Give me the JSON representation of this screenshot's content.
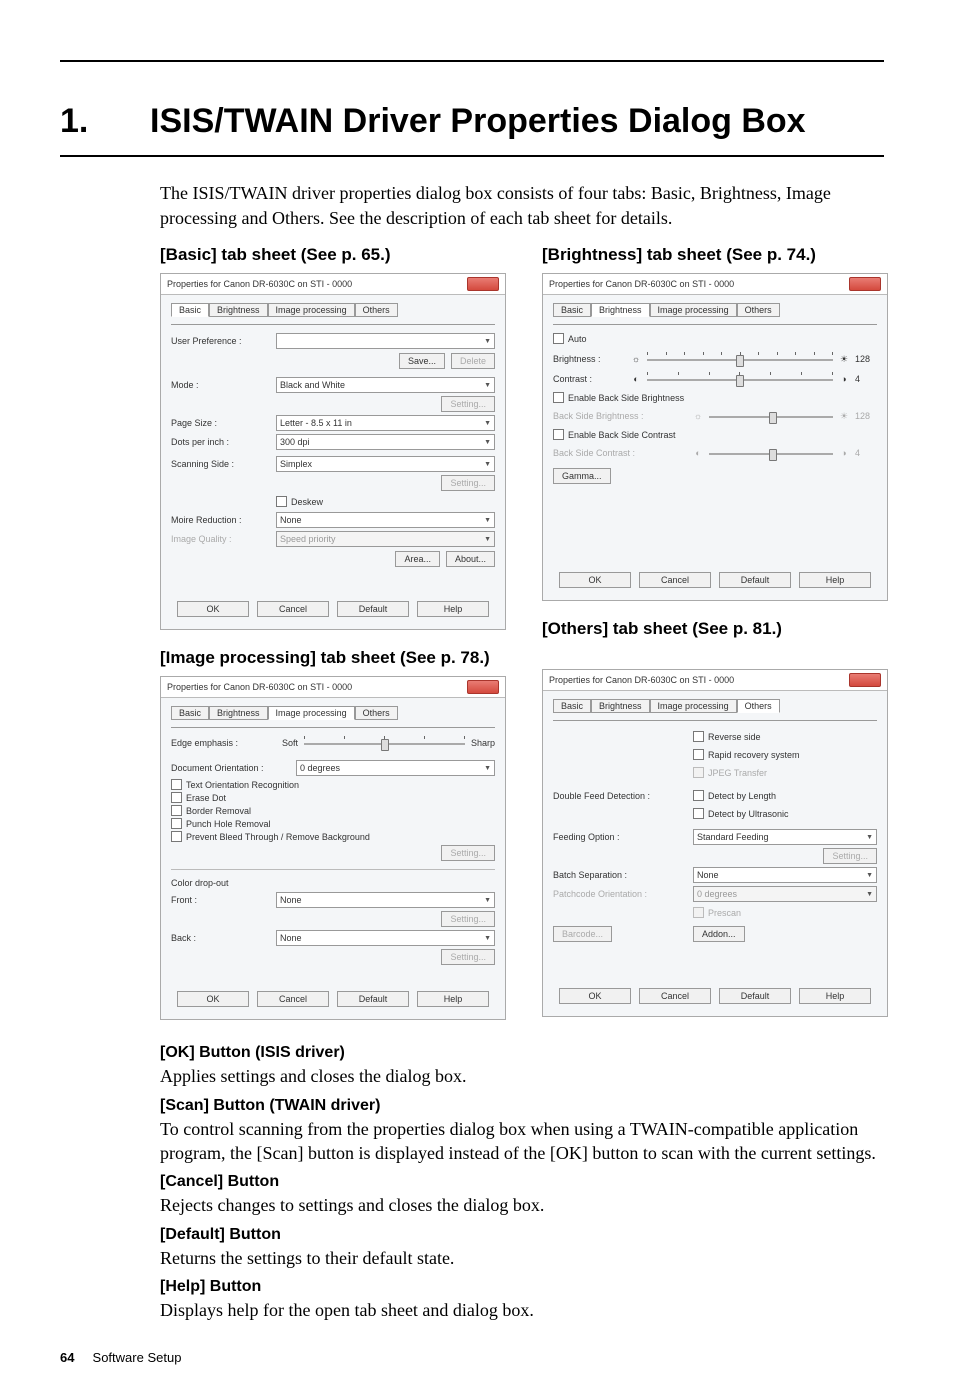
{
  "page_number": "64",
  "footer_label": "Software Setup",
  "chapter": {
    "number": "1.",
    "title": "ISIS/TWAIN Driver Properties Dialog Box"
  },
  "intro": "The ISIS/TWAIN driver properties dialog box consists of four tabs: Basic, Brightness, Image processing and Others. See the description of each tab sheet for details.",
  "sections": {
    "basic": "[Basic] tab sheet (See p. 65.)",
    "brightness": "[Brightness] tab sheet (See p. 74.)",
    "image_processing_title": "[Image processing] tab sheet (See p. 78.)",
    "others": "[Others] tab sheet (See p. 81.)"
  },
  "buttons_explain": {
    "ok_title": "[OK] Button (ISIS driver)",
    "ok_text": "Applies settings and closes the dialog box.",
    "scan_title": "[Scan] Button (TWAIN driver)",
    "scan_text": "To control scanning from the properties dialog box when using a TWAIN-compatible application program, the [Scan] button is displayed instead of the [OK] button to scan with the current settings.",
    "cancel_title": "[Cancel] Button",
    "cancel_text": "Rejects changes to settings and closes the dialog box.",
    "default_title": "[Default] Button",
    "default_text": "Returns the settings to their default state.",
    "help_title": "[Help] Button",
    "help_text": "Displays help for the open tab sheet and dialog box."
  },
  "dialog": {
    "window_title": "Properties for Canon DR-6030C on STI - 0000",
    "tabs": {
      "basic": "Basic",
      "brightness": "Brightness",
      "image_processing": "Image processing",
      "others": "Others"
    },
    "footer_buttons": {
      "ok": "OK",
      "cancel": "Cancel",
      "default": "Default",
      "help": "Help"
    }
  },
  "basic_tab": {
    "user_preference": "User Preference :",
    "save": "Save...",
    "delete": "Delete",
    "mode": "Mode :",
    "mode_val": "Black and White",
    "setting": "Setting...",
    "page_size": "Page Size :",
    "page_size_val": "Letter - 8.5 x 11 in",
    "dots": "Dots per inch :",
    "dots_val": "300 dpi",
    "scanning_side": "Scanning Side :",
    "scanning_side_val": "Simplex",
    "deskew": "Deskew",
    "moire": "Moire Reduction :",
    "moire_val": "None",
    "image_quality": "Image Quality :",
    "image_quality_val": "Speed priority",
    "area": "Area...",
    "about": "About..."
  },
  "brightness_tab": {
    "auto": "Auto",
    "brightness": "Brightness :",
    "brightness_val": "128",
    "contrast": "Contrast :",
    "contrast_val": "4",
    "enable_bs_brightness": "Enable Back Side Brightness",
    "bs_brightness": "Back Side Brightness :",
    "bs_brightness_val": "128",
    "enable_bs_contrast": "Enable Back Side Contrast",
    "bs_contrast": "Back Side Contrast :",
    "bs_contrast_val": "4",
    "gamma": "Gamma..."
  },
  "image_tab": {
    "edge": "Edge emphasis :",
    "soft": "Soft",
    "sharp": "Sharp",
    "doc_orient": "Document Orientation :",
    "doc_orient_val": "0 degrees",
    "text_orient": "Text Orientation Recognition",
    "erase_dot": "Erase Dot",
    "border_removal": "Border Removal",
    "punch_hole": "Punch Hole Removal",
    "prevent_bleed": "Prevent Bleed Through / Remove Background",
    "setting": "Setting...",
    "color_dropout": "Color drop-out",
    "front": "Front :",
    "front_val": "None",
    "back": "Back :",
    "back_val": "None"
  },
  "others_tab": {
    "reverse_side": "Reverse side",
    "rapid_recovery": "Rapid recovery system",
    "jpeg_transfer": "JPEG Transfer",
    "double_feed": "Double Feed Detection :",
    "detect_length": "Detect by Length",
    "detect_ultrasonic": "Detect by Ultrasonic",
    "feeding_option": "Feeding Option :",
    "feeding_option_val": "Standard Feeding",
    "setting": "Setting...",
    "batch_sep": "Batch Separation :",
    "batch_sep_val": "None",
    "patch_orient": "Patchcode Orientation :",
    "patch_orient_val": "0 degrees",
    "prescan": "Prescan",
    "barcode": "Barcode...",
    "addon": "Addon..."
  }
}
